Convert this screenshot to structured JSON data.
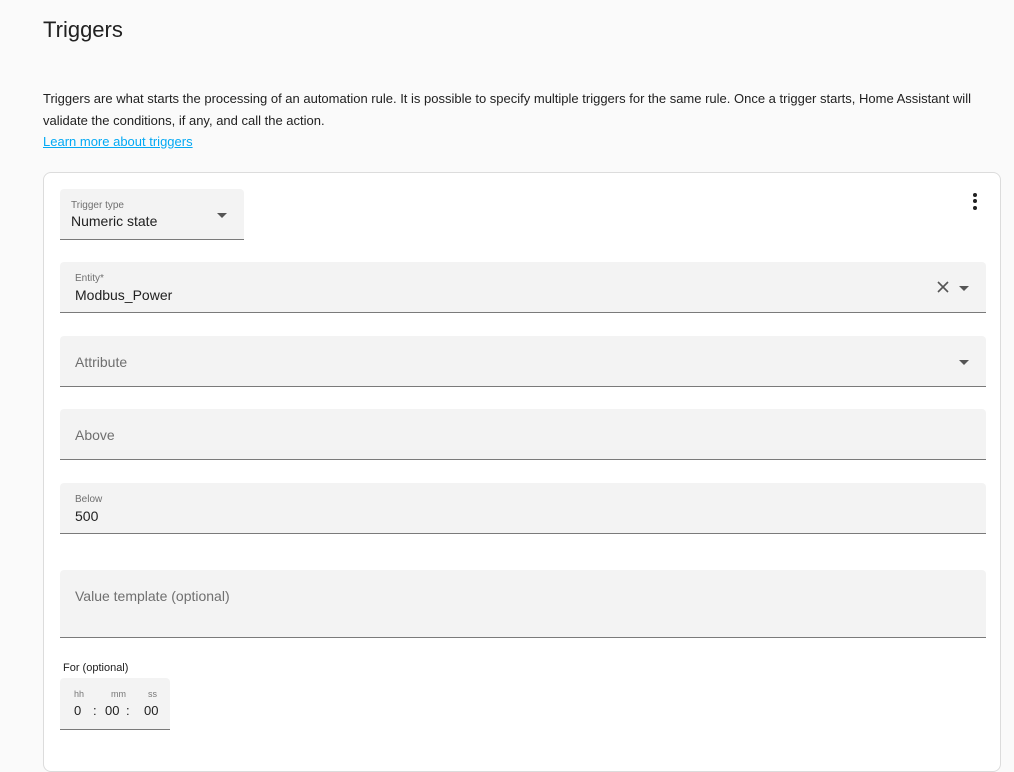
{
  "header": {
    "title": "Triggers",
    "description": "Triggers are what starts the processing of an automation rule. It is possible to specify multiple triggers for the same rule. Once a trigger starts, Home Assistant will validate the conditions, if any, and call the action.",
    "learn_more": "Learn more about triggers"
  },
  "trigger": {
    "menu_icon": "dots-vertical-icon",
    "type_label": "Trigger type",
    "type_value": "Numeric state",
    "entity_label": "Entity*",
    "entity_value": "Modbus_Power",
    "attribute_label": "Attribute",
    "above_label": "Above",
    "below_label": "Below",
    "below_value": "500",
    "template_label": "Value template (optional)",
    "for_label": "For (optional)",
    "duration": {
      "hh_label": "hh",
      "mm_label": "mm",
      "ss_label": "ss",
      "hh": "0",
      "mm": "00",
      "ss": "00",
      "sep": ":"
    }
  },
  "colors": {
    "link": "#03a9f4",
    "field_bg": "#f3f3f3",
    "text": "#212121"
  }
}
